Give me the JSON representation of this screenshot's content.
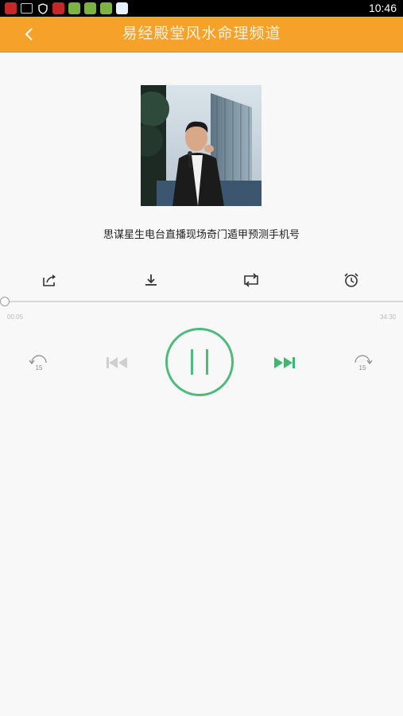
{
  "status_bar": {
    "time": "10:46",
    "icons": [
      "app-red-icon",
      "cast-icon",
      "shield-icon",
      "app-red-icon",
      "app-green-icon",
      "app-green-icon",
      "app-green-icon",
      "app-blue-icon"
    ]
  },
  "header": {
    "title": "易经殿堂风水命理频道",
    "back_icon": "chevron-left-icon",
    "background": "#f5a12a"
  },
  "player": {
    "track_title": "思谋星生电台直播现场奇门遁甲预测手机号",
    "cover_icon": "speaker-photo",
    "actions": [
      "share-icon",
      "download-icon",
      "repeat-icon",
      "alarm-clock-icon"
    ],
    "progress": {
      "elapsed": "00:05",
      "total": "34:30",
      "fraction": 0.002
    },
    "controls": {
      "rewind_label": "15",
      "forward_label": "15",
      "accent_color": "#4cbb7b"
    }
  }
}
